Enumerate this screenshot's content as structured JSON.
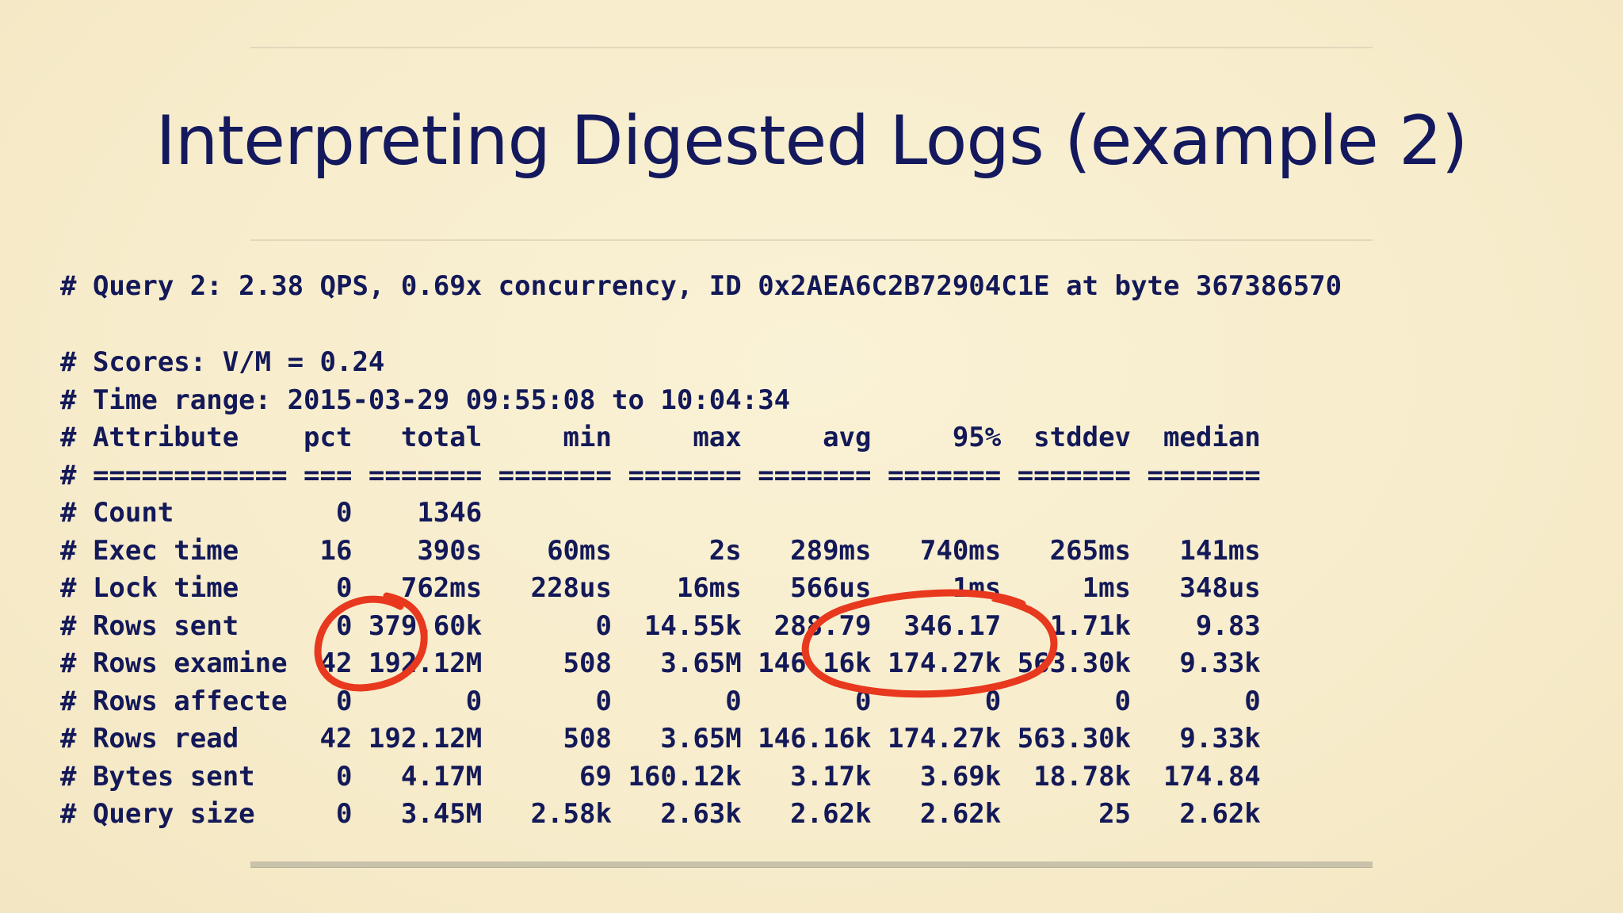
{
  "title": "Interpreting Digested Logs (example 2)",
  "header_line": "# Query 2: 2.38 QPS, 0.69x concurrency, ID 0x2AEA6C2B72904C1E at byte 367386570",
  "score_lines": [
    "# Scores: V/M = 0.24",
    "# Time range: 2015-03-29 09:55:08 to 10:04:34"
  ],
  "table": {
    "columns": [
      "Attribute",
      "pct",
      "total",
      "min",
      "max",
      "avg",
      "95%",
      "stddev",
      "median"
    ],
    "separator": "# ============ === ======= ======= ======= ======= ======= ======= =======",
    "rows": [
      {
        "attribute": "Count",
        "pct": "0",
        "total": "1346",
        "min": "",
        "max": "",
        "avg": "",
        "p95": "",
        "stddev": "",
        "median": ""
      },
      {
        "attribute": "Exec time",
        "pct": "16",
        "total": "390s",
        "min": "60ms",
        "max": "2s",
        "avg": "289ms",
        "p95": "740ms",
        "stddev": "265ms",
        "median": "141ms"
      },
      {
        "attribute": "Lock time",
        "pct": "0",
        "total": "762ms",
        "min": "228us",
        "max": "16ms",
        "avg": "566us",
        "p95": "1ms",
        "stddev": "1ms",
        "median": "348us"
      },
      {
        "attribute": "Rows sent",
        "pct": "0",
        "total": "379.60k",
        "min": "0",
        "max": "14.55k",
        "avg": "288.79",
        "p95": "346.17",
        "stddev": "1.71k",
        "median": "9.83"
      },
      {
        "attribute": "Rows examine",
        "pct": "42",
        "total": "192.12M",
        "min": "508",
        "max": "3.65M",
        "avg": "146.16k",
        "p95": "174.27k",
        "stddev": "563.30k",
        "median": "9.33k"
      },
      {
        "attribute": "Rows affecte",
        "pct": "0",
        "total": "0",
        "min": "0",
        "max": "0",
        "avg": "0",
        "p95": "0",
        "stddev": "0",
        "median": "0"
      },
      {
        "attribute": "Rows read",
        "pct": "42",
        "total": "192.12M",
        "min": "508",
        "max": "3.65M",
        "avg": "146.16k",
        "p95": "174.27k",
        "stddev": "563.30k",
        "median": "9.33k"
      },
      {
        "attribute": "Bytes sent",
        "pct": "0",
        "total": "4.17M",
        "min": "69",
        "max": "160.12k",
        "avg": "3.17k",
        "p95": "3.69k",
        "stddev": "18.78k",
        "median": "174.84"
      },
      {
        "attribute": "Query size",
        "pct": "0",
        "total": "3.45M",
        "min": "2.58k",
        "max": "2.63k",
        "avg": "2.62k",
        "p95": "2.62k",
        "stddev": "25",
        "median": "2.62k"
      }
    ]
  },
  "colors": {
    "background": "#f8efcf",
    "text": "#131958",
    "annotation": "#e8381e"
  }
}
